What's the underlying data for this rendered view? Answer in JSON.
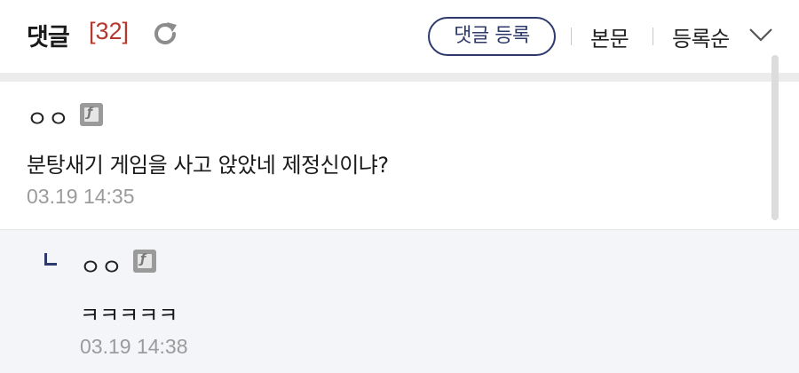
{
  "header": {
    "title": "댓글",
    "count": "[32]",
    "refresh_icon": "refresh-icon",
    "write_button": "댓글 등록",
    "sort_body": "본문",
    "sort_register": "등록순",
    "dropdown_icon": "chevron-down-icon"
  },
  "colors": {
    "accent": "#2d3a6b",
    "count": "#b3392f",
    "timestamp": "#9b9b9b",
    "reply_bg": "#f4f5f9"
  },
  "comments": [
    {
      "author": "ㅇㅇ",
      "text": "분탕새기 게임을 사고 앉았네 제정신이냐?",
      "time": "03.19 14:35",
      "replies": [
        {
          "author": "ㅇㅇ",
          "text": "ㅋㅋㅋㅋㅋ",
          "time": "03.19 14:38"
        }
      ]
    }
  ]
}
